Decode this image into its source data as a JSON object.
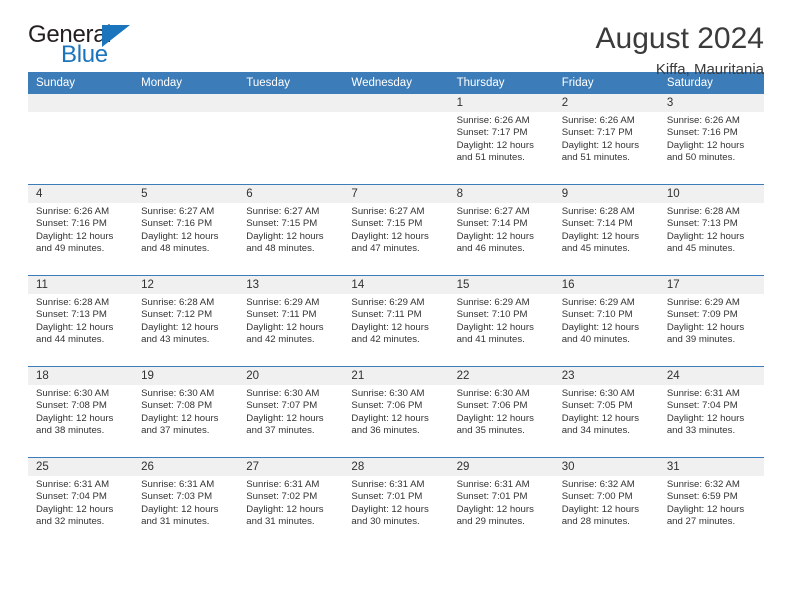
{
  "brand": {
    "name_top": "General",
    "name_bottom": "Blue",
    "accent_color": "#1b75bc",
    "triangle_icon": "triangle-icon"
  },
  "header": {
    "title": "August 2024",
    "subtitle": "Kiffa, Mauritania"
  },
  "calendar": {
    "header_bg": "#3c7cb8",
    "daynum_bg": "#f0f0f0",
    "weekdays": [
      "Sunday",
      "Monday",
      "Tuesday",
      "Wednesday",
      "Thursday",
      "Friday",
      "Saturday"
    ],
    "labels": {
      "sunrise": "Sunrise:",
      "sunset": "Sunset:",
      "daylight": "Daylight:"
    },
    "weeks": [
      [
        {
          "day": ""
        },
        {
          "day": ""
        },
        {
          "day": ""
        },
        {
          "day": ""
        },
        {
          "day": "1",
          "sunrise": "Sunrise: 6:26 AM",
          "sunset": "Sunset: 7:17 PM",
          "daylight_1": "Daylight: 12 hours",
          "daylight_2": "and 51 minutes."
        },
        {
          "day": "2",
          "sunrise": "Sunrise: 6:26 AM",
          "sunset": "Sunset: 7:17 PM",
          "daylight_1": "Daylight: 12 hours",
          "daylight_2": "and 51 minutes."
        },
        {
          "day": "3",
          "sunrise": "Sunrise: 6:26 AM",
          "sunset": "Sunset: 7:16 PM",
          "daylight_1": "Daylight: 12 hours",
          "daylight_2": "and 50 minutes."
        }
      ],
      [
        {
          "day": "4",
          "sunrise": "Sunrise: 6:26 AM",
          "sunset": "Sunset: 7:16 PM",
          "daylight_1": "Daylight: 12 hours",
          "daylight_2": "and 49 minutes."
        },
        {
          "day": "5",
          "sunrise": "Sunrise: 6:27 AM",
          "sunset": "Sunset: 7:16 PM",
          "daylight_1": "Daylight: 12 hours",
          "daylight_2": "and 48 minutes."
        },
        {
          "day": "6",
          "sunrise": "Sunrise: 6:27 AM",
          "sunset": "Sunset: 7:15 PM",
          "daylight_1": "Daylight: 12 hours",
          "daylight_2": "and 48 minutes."
        },
        {
          "day": "7",
          "sunrise": "Sunrise: 6:27 AM",
          "sunset": "Sunset: 7:15 PM",
          "daylight_1": "Daylight: 12 hours",
          "daylight_2": "and 47 minutes."
        },
        {
          "day": "8",
          "sunrise": "Sunrise: 6:27 AM",
          "sunset": "Sunset: 7:14 PM",
          "daylight_1": "Daylight: 12 hours",
          "daylight_2": "and 46 minutes."
        },
        {
          "day": "9",
          "sunrise": "Sunrise: 6:28 AM",
          "sunset": "Sunset: 7:14 PM",
          "daylight_1": "Daylight: 12 hours",
          "daylight_2": "and 45 minutes."
        },
        {
          "day": "10",
          "sunrise": "Sunrise: 6:28 AM",
          "sunset": "Sunset: 7:13 PM",
          "daylight_1": "Daylight: 12 hours",
          "daylight_2": "and 45 minutes."
        }
      ],
      [
        {
          "day": "11",
          "sunrise": "Sunrise: 6:28 AM",
          "sunset": "Sunset: 7:13 PM",
          "daylight_1": "Daylight: 12 hours",
          "daylight_2": "and 44 minutes."
        },
        {
          "day": "12",
          "sunrise": "Sunrise: 6:28 AM",
          "sunset": "Sunset: 7:12 PM",
          "daylight_1": "Daylight: 12 hours",
          "daylight_2": "and 43 minutes."
        },
        {
          "day": "13",
          "sunrise": "Sunrise: 6:29 AM",
          "sunset": "Sunset: 7:11 PM",
          "daylight_1": "Daylight: 12 hours",
          "daylight_2": "and 42 minutes."
        },
        {
          "day": "14",
          "sunrise": "Sunrise: 6:29 AM",
          "sunset": "Sunset: 7:11 PM",
          "daylight_1": "Daylight: 12 hours",
          "daylight_2": "and 42 minutes."
        },
        {
          "day": "15",
          "sunrise": "Sunrise: 6:29 AM",
          "sunset": "Sunset: 7:10 PM",
          "daylight_1": "Daylight: 12 hours",
          "daylight_2": "and 41 minutes."
        },
        {
          "day": "16",
          "sunrise": "Sunrise: 6:29 AM",
          "sunset": "Sunset: 7:10 PM",
          "daylight_1": "Daylight: 12 hours",
          "daylight_2": "and 40 minutes."
        },
        {
          "day": "17",
          "sunrise": "Sunrise: 6:29 AM",
          "sunset": "Sunset: 7:09 PM",
          "daylight_1": "Daylight: 12 hours",
          "daylight_2": "and 39 minutes."
        }
      ],
      [
        {
          "day": "18",
          "sunrise": "Sunrise: 6:30 AM",
          "sunset": "Sunset: 7:08 PM",
          "daylight_1": "Daylight: 12 hours",
          "daylight_2": "and 38 minutes."
        },
        {
          "day": "19",
          "sunrise": "Sunrise: 6:30 AM",
          "sunset": "Sunset: 7:08 PM",
          "daylight_1": "Daylight: 12 hours",
          "daylight_2": "and 37 minutes."
        },
        {
          "day": "20",
          "sunrise": "Sunrise: 6:30 AM",
          "sunset": "Sunset: 7:07 PM",
          "daylight_1": "Daylight: 12 hours",
          "daylight_2": "and 37 minutes."
        },
        {
          "day": "21",
          "sunrise": "Sunrise: 6:30 AM",
          "sunset": "Sunset: 7:06 PM",
          "daylight_1": "Daylight: 12 hours",
          "daylight_2": "and 36 minutes."
        },
        {
          "day": "22",
          "sunrise": "Sunrise: 6:30 AM",
          "sunset": "Sunset: 7:06 PM",
          "daylight_1": "Daylight: 12 hours",
          "daylight_2": "and 35 minutes."
        },
        {
          "day": "23",
          "sunrise": "Sunrise: 6:30 AM",
          "sunset": "Sunset: 7:05 PM",
          "daylight_1": "Daylight: 12 hours",
          "daylight_2": "and 34 minutes."
        },
        {
          "day": "24",
          "sunrise": "Sunrise: 6:31 AM",
          "sunset": "Sunset: 7:04 PM",
          "daylight_1": "Daylight: 12 hours",
          "daylight_2": "and 33 minutes."
        }
      ],
      [
        {
          "day": "25",
          "sunrise": "Sunrise: 6:31 AM",
          "sunset": "Sunset: 7:04 PM",
          "daylight_1": "Daylight: 12 hours",
          "daylight_2": "and 32 minutes."
        },
        {
          "day": "26",
          "sunrise": "Sunrise: 6:31 AM",
          "sunset": "Sunset: 7:03 PM",
          "daylight_1": "Daylight: 12 hours",
          "daylight_2": "and 31 minutes."
        },
        {
          "day": "27",
          "sunrise": "Sunrise: 6:31 AM",
          "sunset": "Sunset: 7:02 PM",
          "daylight_1": "Daylight: 12 hours",
          "daylight_2": "and 31 minutes."
        },
        {
          "day": "28",
          "sunrise": "Sunrise: 6:31 AM",
          "sunset": "Sunset: 7:01 PM",
          "daylight_1": "Daylight: 12 hours",
          "daylight_2": "and 30 minutes."
        },
        {
          "day": "29",
          "sunrise": "Sunrise: 6:31 AM",
          "sunset": "Sunset: 7:01 PM",
          "daylight_1": "Daylight: 12 hours",
          "daylight_2": "and 29 minutes."
        },
        {
          "day": "30",
          "sunrise": "Sunrise: 6:32 AM",
          "sunset": "Sunset: 7:00 PM",
          "daylight_1": "Daylight: 12 hours",
          "daylight_2": "and 28 minutes."
        },
        {
          "day": "31",
          "sunrise": "Sunrise: 6:32 AM",
          "sunset": "Sunset: 6:59 PM",
          "daylight_1": "Daylight: 12 hours",
          "daylight_2": "and 27 minutes."
        }
      ]
    ]
  }
}
